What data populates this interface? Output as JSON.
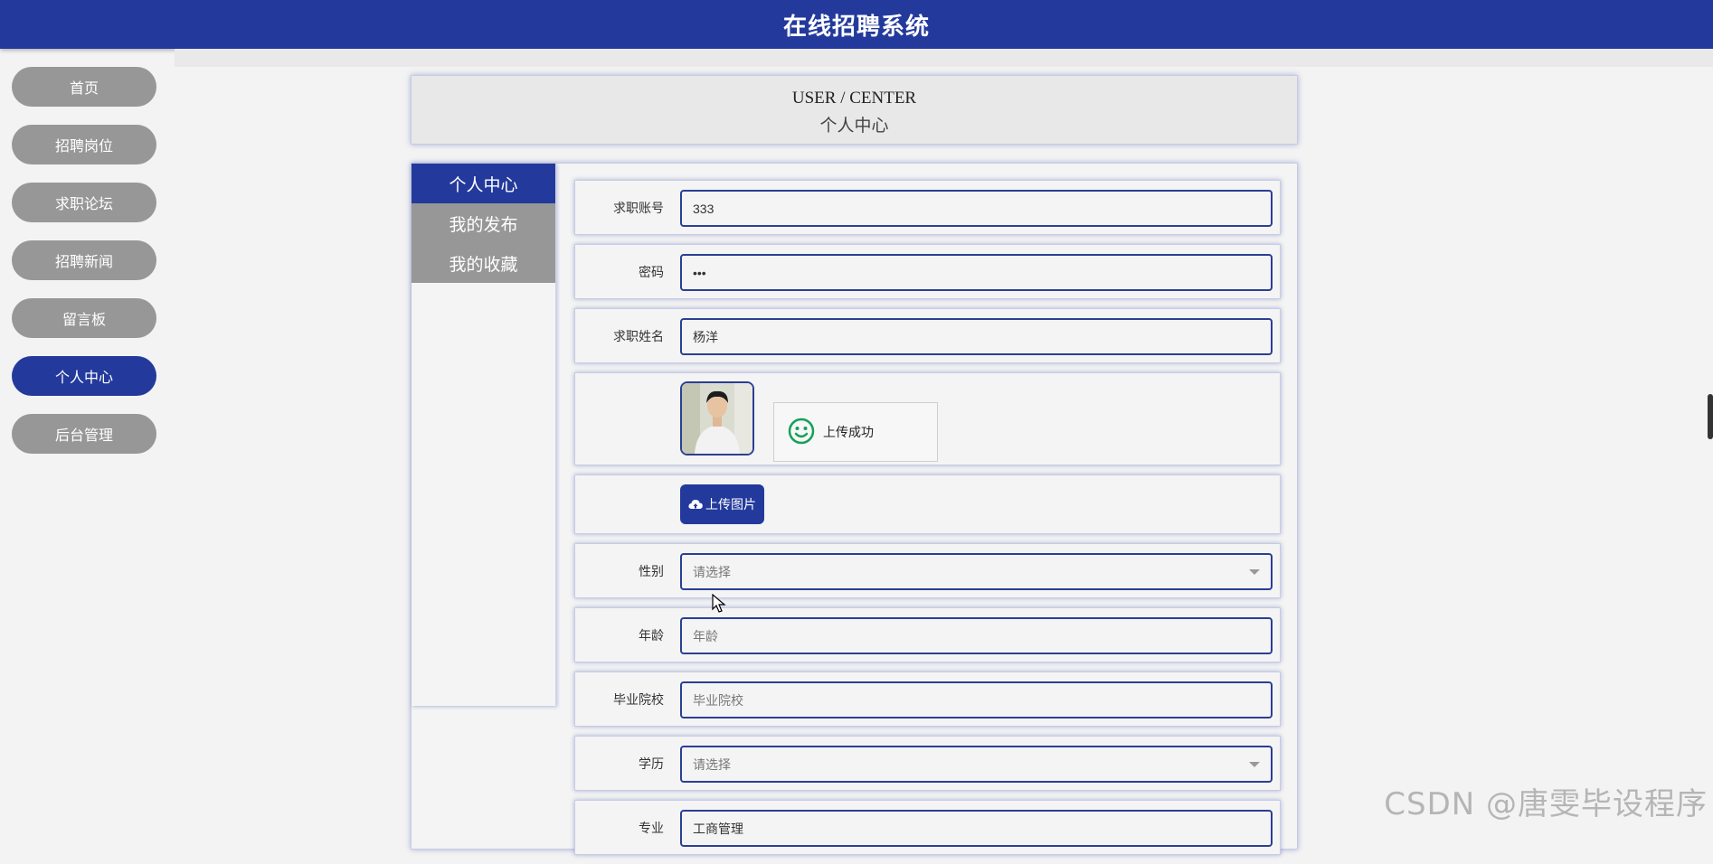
{
  "app": {
    "title": "在线招聘系统"
  },
  "sidebar": {
    "items": [
      {
        "label": "首页",
        "active": false
      },
      {
        "label": "招聘岗位",
        "active": false
      },
      {
        "label": "求职论坛",
        "active": false
      },
      {
        "label": "招聘新闻",
        "active": false
      },
      {
        "label": "留言板",
        "active": false
      },
      {
        "label": "个人中心",
        "active": true
      },
      {
        "label": "后台管理",
        "active": false
      }
    ]
  },
  "header": {
    "title_en": "USER / CENTER",
    "title_zh": "个人中心"
  },
  "tabs": [
    {
      "label": "个人中心",
      "active": true
    },
    {
      "label": "我的发布",
      "active": false
    },
    {
      "label": "我的收藏",
      "active": false
    }
  ],
  "form": {
    "account": {
      "label": "求职账号",
      "value": "333"
    },
    "password": {
      "label": "密码",
      "value": "•••"
    },
    "name": {
      "label": "求职姓名",
      "value": "杨洋"
    },
    "upload_toast": "上传成功",
    "upload_button": "上传图片",
    "gender": {
      "label": "性别",
      "placeholder": "请选择"
    },
    "age": {
      "label": "年龄",
      "placeholder": "年龄"
    },
    "school": {
      "label": "毕业院校",
      "placeholder": "毕业院校"
    },
    "education": {
      "label": "学历",
      "placeholder": "请选择"
    },
    "major": {
      "label": "专业",
      "value": "工商管理"
    }
  },
  "watermark": "CSDN @唐雯毕设程序",
  "colors": {
    "primary": "#233a9c",
    "inactive": "#979797",
    "background": "#f3f3f3"
  },
  "icons": [
    "cloud-upload-icon",
    "smile-icon",
    "chevron-down-icon",
    "mouse-cursor-icon"
  ]
}
